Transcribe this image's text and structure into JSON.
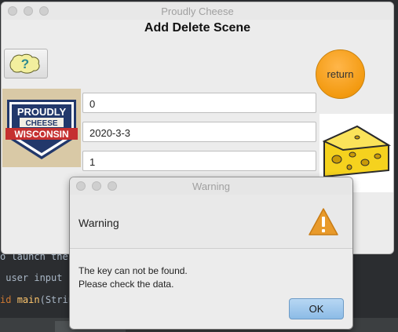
{
  "main_window": {
    "title": "Proudly Cheese",
    "scene_title": "Add Delete Scene",
    "help_button_glyph": "?",
    "return_label": "return",
    "logo": {
      "top": "PROUDLY",
      "middle": "CHEESE",
      "bottom": "WISCONSIN"
    },
    "fields": [
      {
        "value": "0"
      },
      {
        "value": "2020-3-3"
      },
      {
        "value": "1"
      }
    ]
  },
  "dialog": {
    "title": "Warning",
    "heading": "Warning",
    "message_line1": "The key can not be found.",
    "message_line2": "Please check the data.",
    "ok_label": "OK",
    "icon": "warning-triangle-icon"
  },
  "background_code": {
    "line1": "o launch the",
    "line2": " user input",
    "line3_kw": "id ",
    "line3_fn": "main",
    "line3_rest": "(Strin"
  },
  "colors": {
    "return_button": "#f39a10",
    "ok_button": "#8cbbe6",
    "warning_triangle": "#e89a2b"
  }
}
